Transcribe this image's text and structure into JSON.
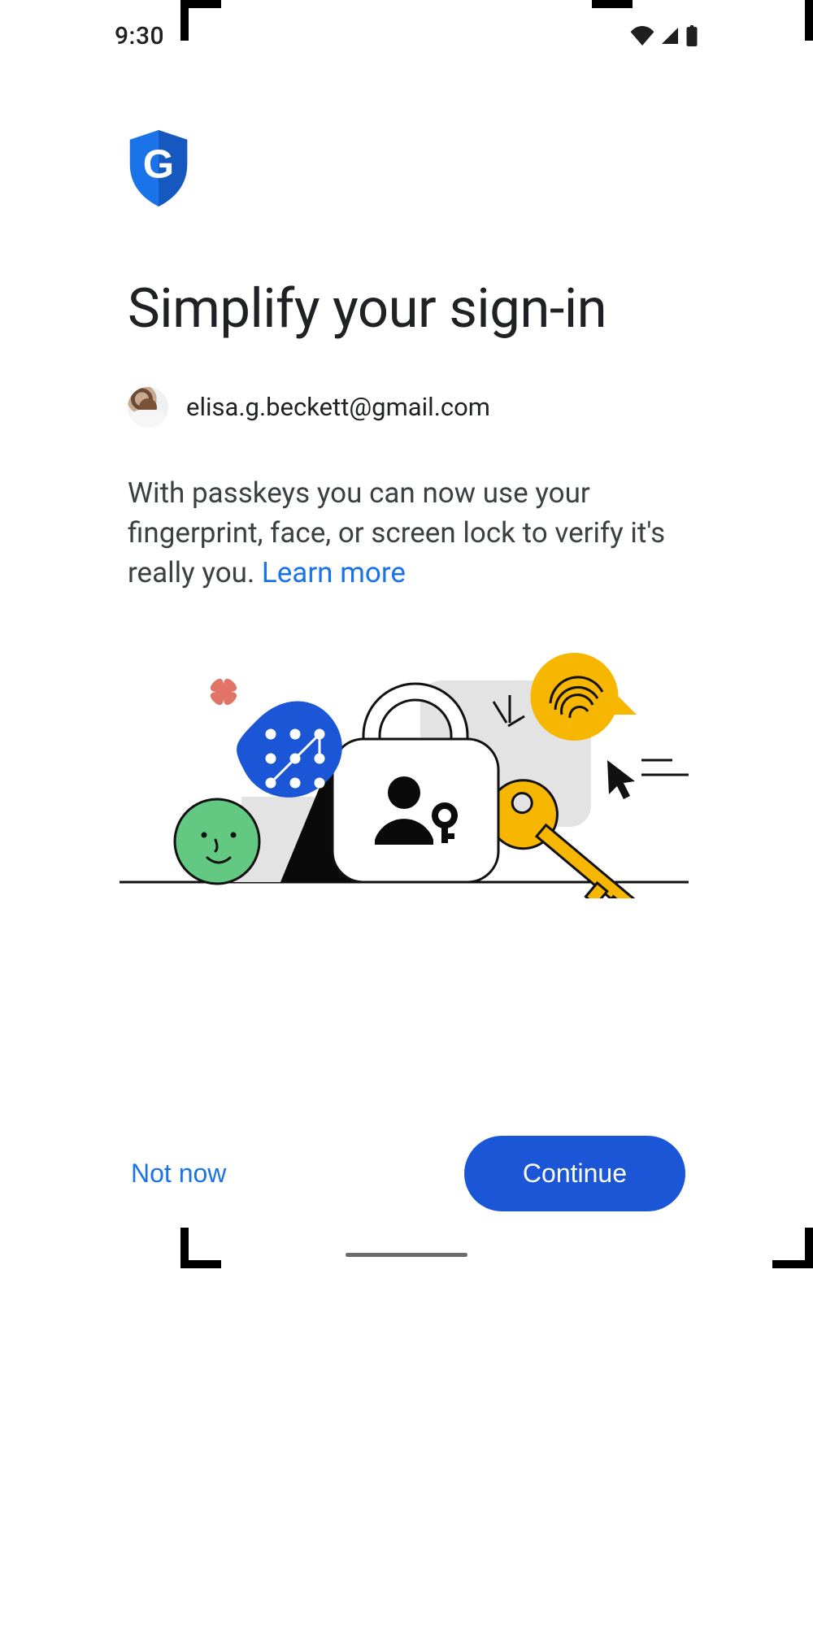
{
  "status": {
    "time": "9:30"
  },
  "header": {
    "title": "Simplify your sign-in"
  },
  "account": {
    "email": "elisa.g.beckett@gmail.com"
  },
  "body": {
    "text": "With passkeys you can now use your fingerprint, face, or screen lock to verify it's really you. ",
    "learn_more": "Learn more"
  },
  "footer": {
    "not_now": "Not now",
    "continue": "Continue"
  },
  "icons": {
    "shield": "google-shield-icon",
    "wifi": "wifi-icon",
    "signal": "cellular-signal-icon",
    "battery": "battery-icon"
  },
  "colors": {
    "link": "#1a73e8",
    "primary": "#1a56d6"
  }
}
